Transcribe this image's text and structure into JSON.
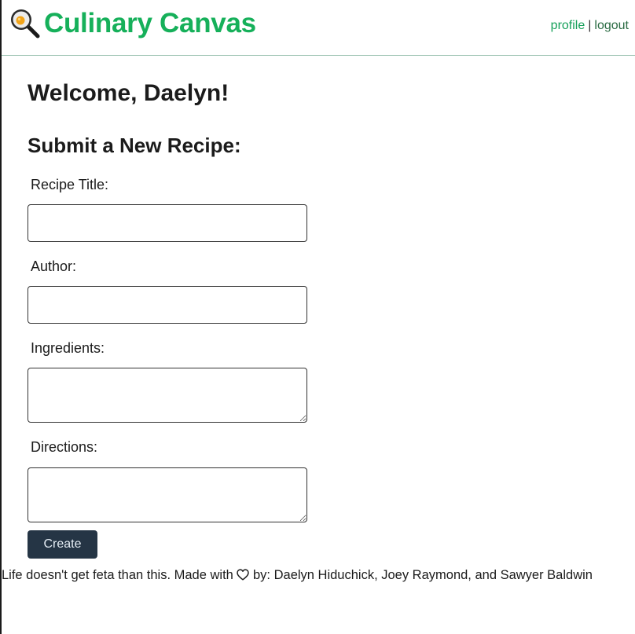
{
  "header": {
    "title": "Culinary Canvas",
    "logo_icon": "frying-pan-egg-icon",
    "nav": {
      "profile_label": "profile",
      "separator": "|",
      "logout_label": "logout"
    }
  },
  "main": {
    "welcome": "Welcome, Daelyn!",
    "form_title": "Submit a New Recipe:",
    "fields": {
      "title_label": "Recipe Title:",
      "title_value": "",
      "author_label": "Author:",
      "author_value": "",
      "ingredients_label": "Ingredients:",
      "ingredients_value": "",
      "directions_label": "Directions:",
      "directions_value": ""
    },
    "create_label": "Create"
  },
  "footer": {
    "text_before_heart": "Life doesn't get feta than this. Made with ",
    "heart_icon": "heart-outline-icon",
    "text_after_heart": " by: Daelyn Hiduchick, Joey Raymond, and Sawyer Baldwin"
  },
  "colors": {
    "brand_green": "#16b05a",
    "button_bg": "#253545"
  }
}
